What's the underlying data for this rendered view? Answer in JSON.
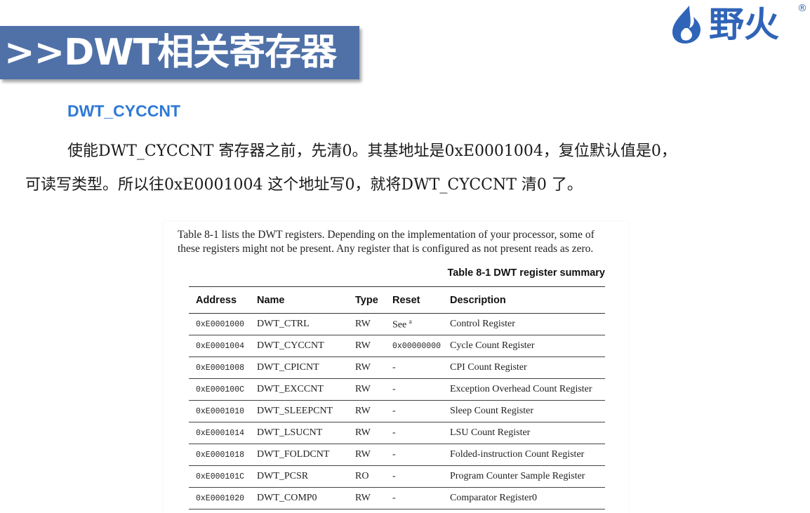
{
  "banner": {
    "title": ">>DWT相关寄存器"
  },
  "logo": {
    "text": "野火",
    "reg_mark": "®",
    "icon": "flame-icon"
  },
  "subheading": "DWT_CYCCNT",
  "paragraph": {
    "line1": "使能DWT_CYCCNT 寄存器之前，先清0。其基地址是0xE0001004，复位默认值是0，",
    "line2": "可读写类型。所以往0xE0001004 这个地址写0，就将DWT_CYCCNT 清0 了。"
  },
  "doc": {
    "intro_line1": "Table 8-1 lists the DWT registers. Depending on the implementation of your processor, some of",
    "intro_line2": "these registers might not be present. Any register that is configured as not present reads as zero.",
    "caption": "Table 8-1 DWT register summary",
    "columns": [
      "Address",
      "Name",
      "Type",
      "Reset",
      "Description"
    ],
    "rows": [
      {
        "address": "0xE0001000",
        "name": "DWT_CTRL",
        "type": "RW",
        "reset": "See",
        "reset_sup": "a",
        "description": "Control Register"
      },
      {
        "address": "0xE0001004",
        "name": "DWT_CYCCNT",
        "type": "RW",
        "reset": "0x00000000",
        "description": "Cycle Count Register"
      },
      {
        "address": "0xE0001008",
        "name": "DWT_CPICNT",
        "type": "RW",
        "reset": "-",
        "description": "CPI Count Register"
      },
      {
        "address": "0xE000100C",
        "name": "DWT_EXCCNT",
        "type": "RW",
        "reset": "-",
        "description": "Exception Overhead Count Register"
      },
      {
        "address": "0xE0001010",
        "name": "DWT_SLEEPCNT",
        "type": "RW",
        "reset": "-",
        "description": "Sleep Count Register"
      },
      {
        "address": "0xE0001014",
        "name": "DWT_LSUCNT",
        "type": "RW",
        "reset": "-",
        "description": "LSU Count Register"
      },
      {
        "address": "0xE0001018",
        "name": "DWT_FOLDCNT",
        "type": "RW",
        "reset": "-",
        "description": "Folded-instruction Count Register"
      },
      {
        "address": "0xE000101C",
        "name": "DWT_PCSR",
        "type": "RO",
        "reset": "-",
        "description": "Program Counter Sample Register"
      },
      {
        "address": "0xE0001020",
        "name": "DWT_COMP0",
        "type": "RW",
        "reset": "-",
        "description": "Comparator Register0"
      }
    ]
  },
  "colors": {
    "banner": "#4f71a8",
    "subheading": "#2e79d6",
    "logo": "#2f64b8"
  }
}
